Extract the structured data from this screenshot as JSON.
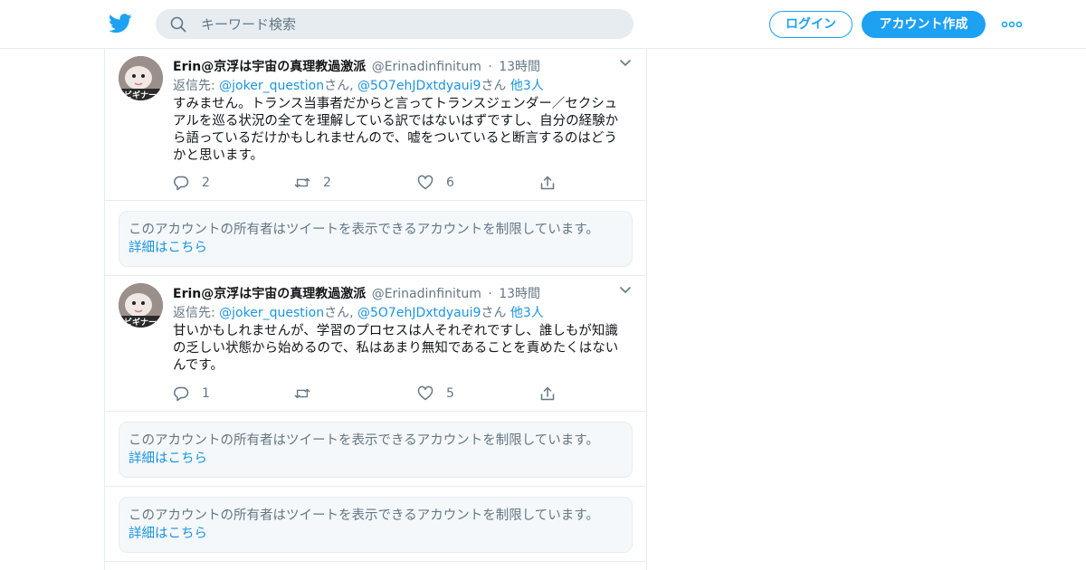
{
  "header": {
    "logo_icon": "twitter-bird-icon",
    "search": {
      "placeholder": "キーワード検索",
      "value": "",
      "icon": "search-icon"
    },
    "login_label": "ログイン",
    "signup_label": "アカウント作成",
    "more_icon": "more-dots-icon"
  },
  "tweets": [
    {
      "author_name": "Erin@京浮は宇宙の真理教過激派",
      "handle": "@Erinadinfinitum",
      "dot": "·",
      "time": "13時間",
      "reply_prefix": "返信先: ",
      "reply_to": [
        "@joker_question",
        "@5O7ehJDxtdyaui9"
      ],
      "reply_san_1": "さん, ",
      "reply_san_2": "さん ",
      "reply_others": "他3人",
      "text": "すみません。トランス当事者だからと言ってトランスジェンダー／セクシュアルを巡る状況の全てを理解している訳ではないはずですし、自分の経験から語っているだけかもしれませんので、嘘をついていると断言するのはどうかと思います。",
      "replies": "2",
      "retweets": "2",
      "likes": "6"
    },
    {
      "author_name": "Erin@京浮は宇宙の真理教過激派",
      "handle": "@Erinadinfinitum",
      "dot": "·",
      "time": "13時間",
      "reply_prefix": "返信先: ",
      "reply_to": [
        "@joker_question",
        "@5O7ehJDxtdyaui9"
      ],
      "reply_san_1": "さん, ",
      "reply_san_2": "さん ",
      "reply_others": "他3人",
      "text": "甘いかもしれませんが、学習のプロセスは人それぞれですし、誰しもが知識の乏しい状態から始めるので、私はあまり無知であることを責めたくはないんです。",
      "replies": "1",
      "retweets": "",
      "likes": "5"
    }
  ],
  "notices": [
    {
      "text": "このアカウントの所有者はツイートを表示できるアカウントを制限しています。",
      "link": "詳細はこちら"
    },
    {
      "text": "このアカウントの所有者はツイートを表示できるアカウントを制限しています。",
      "link": "詳細はこちら"
    },
    {
      "text": "このアカウントの所有者はツイートを表示できるアカウントを制限しています。",
      "link": "詳細はこちら"
    }
  ],
  "colors": {
    "accent": "#1da1f2",
    "link": "#1b95e0",
    "muted": "#657786",
    "border": "#e6ecf0"
  }
}
